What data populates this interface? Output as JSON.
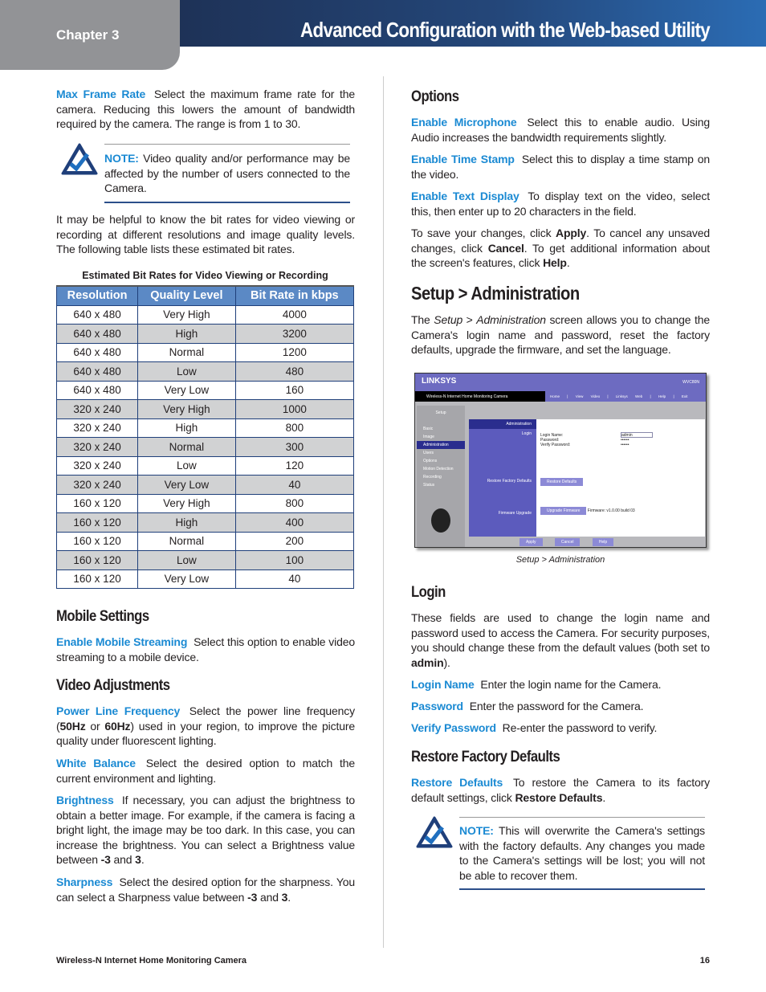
{
  "header": {
    "chapter": "Chapter 3",
    "title": "Advanced Configuration with the Web-based Utility"
  },
  "left": {
    "max_frame_rate": [
      [
        "Max Frame Rate",
        "term"
      ],
      [
        "Select the maximum frame rate for the camera. Reducing this lowers the amount of bandwidth required by the camera. The range is from 1 to 30.",
        ""
      ]
    ],
    "note1": [
      [
        "NOTE:",
        "note"
      ],
      [
        " Video quality and/or performance may be affected by the number of users connected to the Camera.",
        ""
      ]
    ],
    "bitrate_intro": [
      [
        "It may be helpful to know the bit rates for video viewing or recording at different resolutions and image quality levels. The following table lists these estimated bit rates.",
        ""
      ]
    ],
    "table": {
      "caption": "Estimated Bit Rates for Video Viewing or Recording",
      "headers": [
        "Resolution",
        "Quality Level",
        "Bit Rate in kbps"
      ],
      "rows": [
        [
          "640 x 480",
          "Very High",
          "4000"
        ],
        [
          "640 x 480",
          "High",
          "3200"
        ],
        [
          "640 x 480",
          "Normal",
          "1200"
        ],
        [
          "640 x 480",
          "Low",
          "480"
        ],
        [
          "640 x 480",
          "Very Low",
          "160"
        ],
        [
          "320 x 240",
          "Very High",
          "1000"
        ],
        [
          "320 x 240",
          "High",
          "800"
        ],
        [
          "320 x 240",
          "Normal",
          "300"
        ],
        [
          "320 x 240",
          "Low",
          "120"
        ],
        [
          "320 x 240",
          "Very Low",
          "40"
        ],
        [
          "160 x 120",
          "Very High",
          "800"
        ],
        [
          "160 x 120",
          "High",
          "400"
        ],
        [
          "160 x 120",
          "Normal",
          "200"
        ],
        [
          "160 x 120",
          "Low",
          "100"
        ],
        [
          "160 x 120",
          "Very Low",
          "40"
        ]
      ]
    },
    "mobile_heading": "Mobile Settings",
    "mobile_streaming": [
      [
        "Enable Mobile Streaming",
        "term"
      ],
      [
        "Select this option to enable video streaming to a mobile device.",
        ""
      ]
    ],
    "video_heading": "Video Adjustments",
    "power_line": [
      [
        "Power Line Frequency",
        "term"
      ],
      [
        "Select the power line frequency (",
        ""
      ],
      [
        "50Hz",
        "b"
      ],
      [
        " or ",
        ""
      ],
      [
        "60Hz",
        "b"
      ],
      [
        ") used in your region, to improve the picture quality under fluorescent lighting.",
        ""
      ]
    ],
    "white_balance": [
      [
        "White Balance",
        "term"
      ],
      [
        "Select the desired option to match the current environment and lighting.",
        ""
      ]
    ],
    "brightness": [
      [
        "Brightness",
        "term"
      ],
      [
        "If necessary, you can adjust the brightness to obtain a better image. For example, if the camera is facing a bright light, the image may be too dark. In this case, you can increase the brightness. You can select a Brightness value between ",
        ""
      ],
      [
        "-3",
        "b"
      ],
      [
        " and ",
        ""
      ],
      [
        "3",
        "b"
      ],
      [
        ".",
        ""
      ]
    ],
    "sharpness": [
      [
        "Sharpness",
        "term"
      ],
      [
        "Select the desired option for the sharpness. You can select a Sharpness value between ",
        ""
      ],
      [
        "-3",
        "b"
      ],
      [
        " and ",
        ""
      ],
      [
        "3",
        "b"
      ],
      [
        ".",
        ""
      ]
    ]
  },
  "right": {
    "options_heading": "Options",
    "microphone": [
      [
        "Enable Microphone",
        "term"
      ],
      [
        "Select this to enable audio. Using Audio increases the bandwidth requirements slightly.",
        ""
      ]
    ],
    "time_stamp": [
      [
        "Enable Time Stamp",
        "term"
      ],
      [
        "Select this to display a time stamp on the video.",
        ""
      ]
    ],
    "text_display": [
      [
        "Enable Text Display",
        "term"
      ],
      [
        "To display text on the video, select this, then enter up to 20 characters in the field.",
        ""
      ]
    ],
    "save": [
      [
        "To save your changes, click ",
        ""
      ],
      [
        "Apply",
        "b"
      ],
      [
        ". To cancel any unsaved changes, click ",
        ""
      ],
      [
        "Cancel",
        "b"
      ],
      [
        ". To get additional information about the screen's features, click ",
        ""
      ],
      [
        "Help",
        "b"
      ],
      [
        ".",
        ""
      ]
    ],
    "admin_heading": "Setup > Administration",
    "admin_intro": [
      [
        "The ",
        ""
      ],
      [
        "Setup",
        "i"
      ],
      [
        " > ",
        ""
      ],
      [
        "Administration",
        "i"
      ],
      [
        " screen allows you to change the Camera's login name and password, reset the factory defaults, upgrade the firmware, and set the language.",
        ""
      ]
    ],
    "figure_caption": "Setup > Administration",
    "screenshot": {
      "logo": "LINKSYS",
      "model": "WVC80N",
      "product": "Wireless-N Internet Home Monitoring Camera",
      "nav": [
        "Home",
        "|",
        "View Video",
        "|",
        "Linksys Web",
        "|",
        "Help",
        "|",
        "Exit"
      ],
      "section": "Setup",
      "menu": [
        "Basic",
        "Image",
        "Administration",
        "Users",
        "Options",
        "Motion Detection",
        "Recording",
        "Status"
      ],
      "panel": "Administration",
      "login_label": "Login",
      "login_name": "Login Name:",
      "login_value": "admin",
      "password": "Password:",
      "password_value": "••••••",
      "verify": "Verify Password:",
      "verify_value": "••••••",
      "restore_label": "Restore Factory Defaults",
      "restore_btn": "Restore Defaults",
      "firmware_label": "Firmware Upgrade",
      "upgrade_btn": "Upgrade Firmware",
      "firmware": "Firmware: v1.0.00 build 03",
      "buttons": [
        "Apply",
        "Cancel",
        "Help"
      ]
    },
    "login_heading": "Login",
    "login_intro": [
      [
        "These fields are used to change the login name and password used to access the Camera. For security purposes, you should change these from the default values (both set to ",
        ""
      ],
      [
        "admin",
        "b"
      ],
      [
        ").",
        ""
      ]
    ],
    "login_name": [
      [
        "Login Name",
        "term"
      ],
      [
        "Enter the login name for the Camera.",
        ""
      ]
    ],
    "password": [
      [
        "Password",
        "term"
      ],
      [
        "Enter the password for the Camera.",
        ""
      ]
    ],
    "verify_password": [
      [
        "Verify Password",
        "term"
      ],
      [
        "Re-enter the password to verify.",
        ""
      ]
    ],
    "restore_heading": "Restore Factory Defaults",
    "restore": [
      [
        "Restore Defaults",
        "term"
      ],
      [
        "To restore the Camera to its factory default settings, click ",
        ""
      ],
      [
        "Restore Defaults",
        "b"
      ],
      [
        ".",
        ""
      ]
    ],
    "note2": [
      [
        "NOTE:",
        "note"
      ],
      [
        " This will overwrite the Camera's settings with the factory defaults. Any changes you made to the Camera's settings will be lost; you will not be able to recover them.",
        ""
      ]
    ]
  },
  "footer": {
    "product": "Wireless-N Internet Home Monitoring Camera",
    "page": "16"
  }
}
